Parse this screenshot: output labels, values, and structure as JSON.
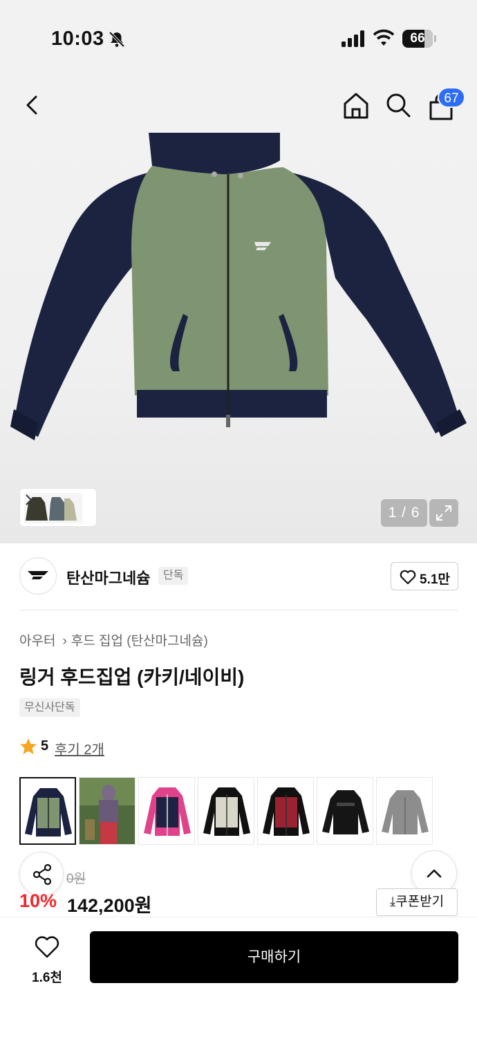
{
  "status_bar": {
    "time": "10:03",
    "battery": "66"
  },
  "header": {
    "cart_count": "67"
  },
  "gallery": {
    "page_indicator": "1 / 6"
  },
  "brand": {
    "name": "탄산마그네슘",
    "tag": "단독",
    "likes": "5.1만"
  },
  "product": {
    "breadcrumb": [
      "아우터",
      "후드 집업 (탄산마그네슘)"
    ],
    "title": "링거 후드집업 (카키/네이비)",
    "badge": "무신사단독",
    "rating": "5",
    "review_link": "후기 2개",
    "original_price_partial": "0원",
    "discount_rate": "10%",
    "sale_price": "142,200원",
    "coupon_label": "쿠폰받기"
  },
  "color_options": [
    {
      "name": "khaki-navy",
      "primary": "#7f9470",
      "secondary": "#1b2341"
    },
    {
      "name": "lookbook-photo",
      "primary": "#6a5a7a",
      "secondary": "#c73845"
    },
    {
      "name": "pink-navy",
      "primary": "#1d2340",
      "secondary": "#e0428c"
    },
    {
      "name": "cream-black",
      "primary": "#d9d8c8",
      "secondary": "#111111"
    },
    {
      "name": "red-black",
      "primary": "#9b2230",
      "secondary": "#111111"
    },
    {
      "name": "black",
      "primary": "#151515",
      "secondary": "#151515"
    },
    {
      "name": "grey",
      "primary": "#8d8d8d",
      "secondary": "#8d8d8d"
    }
  ],
  "bottom_bar": {
    "wish_count": "1.6천",
    "buy_label": "구매하기"
  },
  "colors": {
    "accent_blue": "#2d6df6",
    "discount_red": "#f1262d",
    "buy_button": "#000000"
  }
}
